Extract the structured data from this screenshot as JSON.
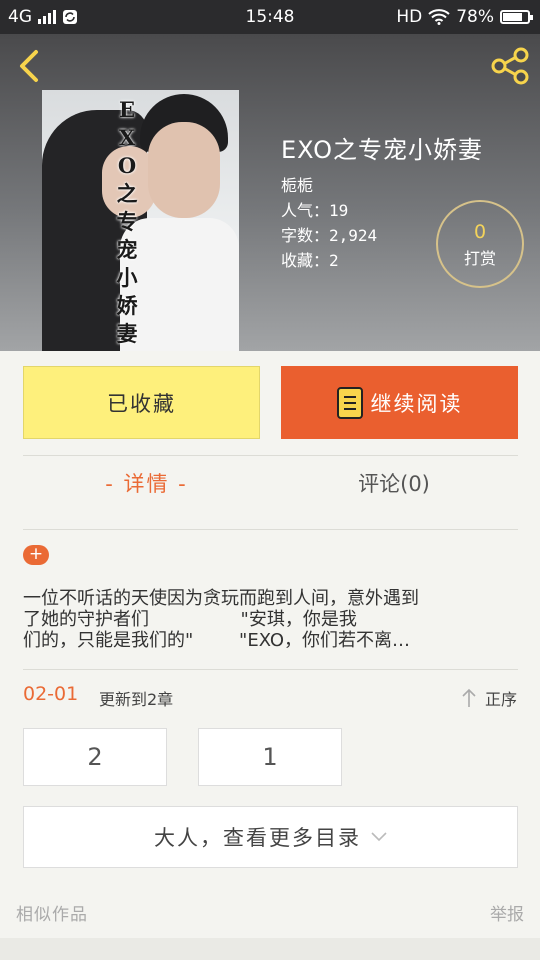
{
  "status_bar": {
    "network": "4G",
    "time": "15:48",
    "hd": "HD",
    "battery": "78%",
    "battery_level": 0.78
  },
  "header": {
    "back_icon": "chevron-left-icon",
    "share_icon": "share-icon"
  },
  "book": {
    "cover_title": "EXO之专宠小娇妻",
    "title": "EXO之专宠小娇妻",
    "author": "栀栀",
    "popularity": "人气：19",
    "word_count": "字数：2,924",
    "favorites": "收藏：2"
  },
  "tip": {
    "count": "0",
    "label": "打赏"
  },
  "actions": {
    "favorite_label": "已收藏",
    "read_label": "继续阅读"
  },
  "tabs": {
    "detail": "- 详情 -",
    "comments": "评论(0)"
  },
  "description": {
    "expand": "+",
    "line1": "一位不听话的天使因为贪玩而跑到人间，意外遇到",
    "line2": "了她的守护者们                \"安琪，你是我",
    "line3": "们的，只能是我们的\"        \"EXO，你们若不离…"
  },
  "update": {
    "date": "02-01",
    "text": "更新到2章",
    "sort_label": "正序"
  },
  "chapters": [
    "2",
    "1"
  ],
  "more_catalog": "大人，查看更多目录",
  "footer": {
    "similar": "相似作品",
    "report": "举报"
  },
  "colors": {
    "accent": "#ea6a35",
    "favorite_bg": "#fef07c",
    "read_bg": "#ea5f2f",
    "tip_number": "#f3d35b"
  }
}
